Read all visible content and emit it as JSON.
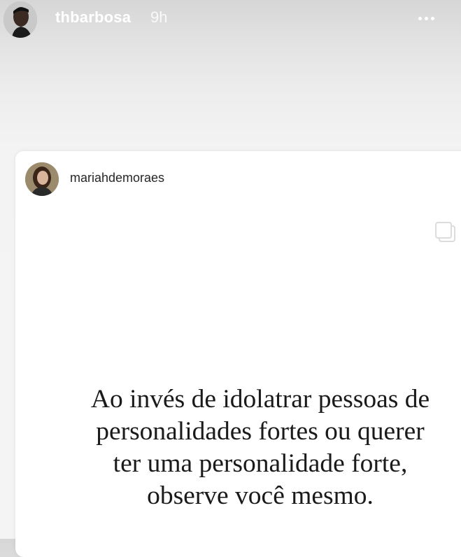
{
  "story_header": {
    "username": "thbarbosa",
    "time": "9h",
    "more_icon": "more-horizontal-icon"
  },
  "shared_post": {
    "username": "mariahdemoraes",
    "media_icon": "carousel-icon",
    "quote_lines": [
      "Ao invés de idolatrar pessoas de",
      "personalidades fortes ou querer",
      "ter uma personalidade forte,",
      "observe você mesmo."
    ]
  }
}
